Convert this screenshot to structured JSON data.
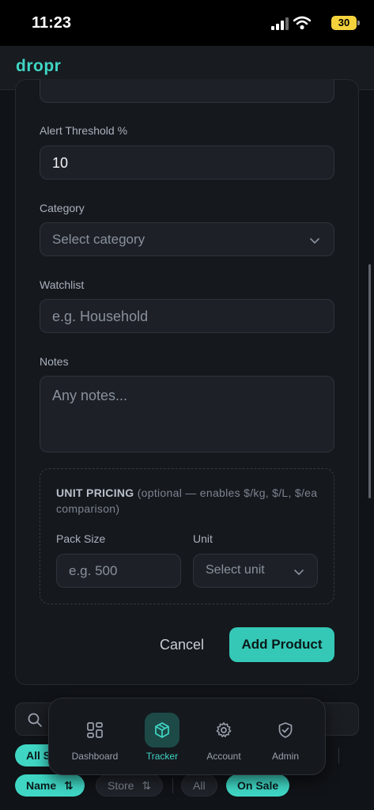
{
  "status_bar": {
    "time": "11:23",
    "battery": "30"
  },
  "app": {
    "logo": "dropr"
  },
  "form": {
    "alert_threshold": {
      "label": "Alert Threshold %",
      "value": "10"
    },
    "category": {
      "label": "Category",
      "placeholder": "Select category"
    },
    "watchlist": {
      "label": "Watchlist",
      "placeholder": "e.g. Household"
    },
    "notes": {
      "label": "Notes",
      "placeholder": "Any notes..."
    },
    "unit_pricing": {
      "heading": "UNIT PRICING",
      "hint": "(optional — enables $/kg, $/L, $/ea comparison)",
      "pack_size": {
        "label": "Pack Size",
        "placeholder": "e.g. 500"
      },
      "unit": {
        "label": "Unit",
        "placeholder": "Select unit"
      }
    },
    "cancel_label": "Cancel",
    "submit_label": "Add Product"
  },
  "filters": {
    "chips_top": [
      "All S"
    ],
    "sort_chips": [
      {
        "label": "Name",
        "sort_glyph": "⇅"
      },
      {
        "label": "Store",
        "sort_glyph": "⇅"
      }
    ],
    "filter_chips": [
      "All",
      "On Sale"
    ]
  },
  "nav": {
    "items": [
      {
        "label": "Dashboard",
        "icon": "grid-icon",
        "active": false
      },
      {
        "label": "Tracker",
        "icon": "box-icon",
        "active": true
      },
      {
        "label": "Account",
        "icon": "gear-icon",
        "active": false
      },
      {
        "label": "Admin",
        "icon": "shield-icon",
        "active": false
      }
    ]
  },
  "colors": {
    "accent": "#3fd6c4",
    "background": "#101317",
    "field": "#1d2127"
  }
}
